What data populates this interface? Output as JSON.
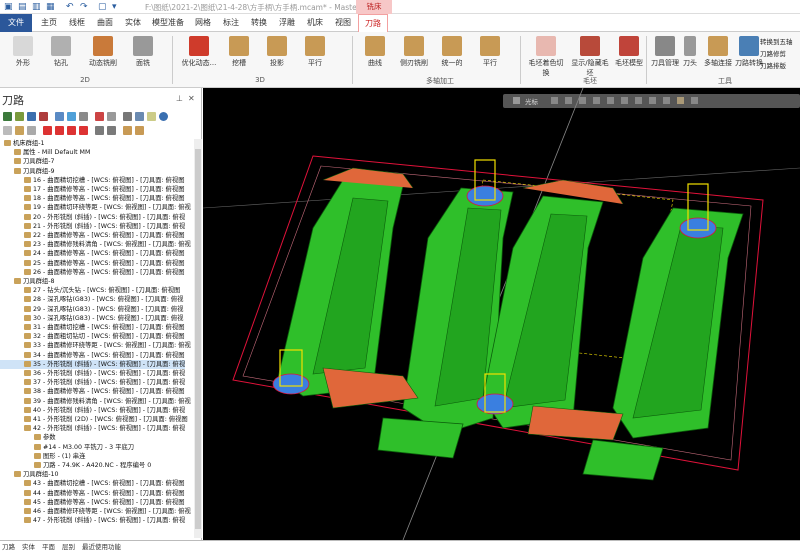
{
  "titlebar": {
    "path": "F:\\图纸\\2021-2\\图纸\\21-4-28\\方手柄\\方手柄.mcam* - Mastercam 铣...",
    "context_tab": "铣床"
  },
  "tabs": [
    "文件",
    "主页",
    "线框",
    "曲面",
    "实体",
    "模型准备",
    "网格",
    "标注",
    "转换",
    "浮雕",
    "机床",
    "视图",
    "刀路"
  ],
  "ribbon": {
    "buttons_2d": [
      "外形",
      "钻孔",
      "动态铣削",
      "面铣"
    ],
    "group_2d": "2D",
    "buttons_3d": [
      "优化动态...",
      "挖槽",
      "投影",
      "平行"
    ],
    "group_3d": "3D",
    "buttons_multi": [
      "曲线",
      "侧刃铣削",
      "统一的",
      "平行"
    ],
    "group_multi": "多轴加工",
    "buttons_stock": [
      "毛坯着色切换",
      "显示/隐藏毛坯",
      "毛坯模型"
    ],
    "group_stock": "毛坯",
    "buttons_tools": [
      "刀具管理",
      "刀头",
      "多轴连接",
      "刀路转换"
    ],
    "group_tools": "工具",
    "side_items": [
      "转换到五轴",
      "刀路修剪",
      "刀路排版"
    ]
  },
  "panel": {
    "title": "刀路",
    "tree": [
      {
        "indent": 0,
        "text": "机床群组-1"
      },
      {
        "indent": 1,
        "text": "属性 - Mill Default MM"
      },
      {
        "indent": 1,
        "text": "刀具群组-7"
      },
      {
        "indent": 1,
        "text": "刀具群组-9"
      },
      {
        "indent": 2,
        "text": "16 - 曲面精切挖槽 - [WCS: 俯视图] - [刀具面: 俯视图"
      },
      {
        "indent": 2,
        "text": "17 - 曲面精修等高 - [WCS: 俯视图] - [刀具面: 俯视图"
      },
      {
        "indent": 2,
        "text": "18 - 曲面精修等高 - [WCS: 俯视图] - [刀具面: 俯视图"
      },
      {
        "indent": 2,
        "text": "19 - 曲面精切环绕等距 - [WCS: 俯视图] - [刀具面: 俯视"
      },
      {
        "indent": 2,
        "text": "20 - 外形铣削 (斜插) - [WCS: 俯视图] - [刀具面: 俯视"
      },
      {
        "indent": 2,
        "text": "21 - 外形铣削 (斜插) - [WCS: 俯视图] - [刀具面: 俯视"
      },
      {
        "indent": 2,
        "text": "22 - 曲面精修等高 - [WCS: 俯视图] - [刀具面: 俯视图"
      },
      {
        "indent": 2,
        "text": "23 - 曲面精修残料清角 - [WCS: 俯视图] - [刀具面: 俯视"
      },
      {
        "indent": 2,
        "text": "24 - 曲面精修等高 - [WCS: 俯视图] - [刀具面: 俯视图"
      },
      {
        "indent": 2,
        "text": "25 - 曲面精修等高 - [WCS: 俯视图] - [刀具面: 俯视图"
      },
      {
        "indent": 2,
        "text": "26 - 曲面精修等高 - [WCS: 俯视图] - [刀具面: 俯视图"
      },
      {
        "indent": 1,
        "text": "刀具群组-8"
      },
      {
        "indent": 2,
        "text": "27 - 钻头/沉头钻 - [WCS: 俯视图] - [刀具面: 俯视图"
      },
      {
        "indent": 2,
        "text": "28 - 深孔啄钻(G83) - [WCS: 俯视图] - [刀具面: 俯视"
      },
      {
        "indent": 2,
        "text": "29 - 深孔啄钻(G83) - [WCS: 俯视图] - [刀具面: 俯视"
      },
      {
        "indent": 2,
        "text": "30 - 深孔啄钻(G83) - [WCS: 俯视图] - [刀具面: 俯视"
      },
      {
        "indent": 2,
        "text": "31 - 曲面精切挖槽 - [WCS: 俯视图] - [刀具面: 俯视图"
      },
      {
        "indent": 2,
        "text": "32 - 曲面粗切钻切 - [WCS: 俯视图] - [刀具面: 俯视图"
      },
      {
        "indent": 2,
        "text": "33 - 曲面精修环绕等距 - [WCS: 俯视图] - [刀具面: 俯视"
      },
      {
        "indent": 2,
        "text": "34 - 曲面精修等高 - [WCS: 俯视图] - [刀具面: 俯视图"
      },
      {
        "indent": 2,
        "text": "35 - 外形铣削 (斜插) - [WCS: 俯视图] - [刀具面: 俯视",
        "selected": true
      },
      {
        "indent": 2,
        "text": "36 - 外形铣削 (斜插) - [WCS: 俯视图] - [刀具面: 俯视"
      },
      {
        "indent": 2,
        "text": "37 - 外形铣削 (斜插) - [WCS: 俯视图] - [刀具面: 俯视"
      },
      {
        "indent": 2,
        "text": "38 - 曲面精修等高 - [WCS: 俯视图] - [刀具面: 俯视图"
      },
      {
        "indent": 2,
        "text": "39 - 曲面精修残料清角 - [WCS: 俯视图] - [刀具面: 俯视"
      },
      {
        "indent": 2,
        "text": "40 - 外形铣削 (斜插) - [WCS: 俯视图] - [刀具面: 俯视"
      },
      {
        "indent": 2,
        "text": "41 - 外形铣削 (2D) - [WCS: 俯视图] - [刀具面: 俯视图"
      },
      {
        "indent": 2,
        "text": "42 - 外形铣削 (斜插) - [WCS: 俯视图] - [刀具面: 俯视"
      },
      {
        "indent": 3,
        "text": "参数"
      },
      {
        "indent": 3,
        "text": "#14 - M3.00 平铣刀 - 3 平底刀"
      },
      {
        "indent": 3,
        "text": "图形 - (1) 串连"
      },
      {
        "indent": 3,
        "text": "刀路 - 74.9K - A420.NC - 程序编号 0"
      },
      {
        "indent": 1,
        "text": "刀具群组-10"
      },
      {
        "indent": 2,
        "text": "43 - 曲面精切挖槽 - [WCS: 俯视图] - [刀具面: 俯视图"
      },
      {
        "indent": 2,
        "text": "44 - 曲面精修等高 - [WCS: 俯视图] - [刀具面: 俯视图"
      },
      {
        "indent": 2,
        "text": "45 - 曲面精修等高 - [WCS: 俯视图] - [刀具面: 俯视图"
      },
      {
        "indent": 2,
        "text": "46 - 曲面精修环绕等距 - [WCS: 俯视图] - [刀具面: 俯视"
      },
      {
        "indent": 2,
        "text": "47 - 外形铣削 (斜插) - [WCS: 俯视图] - [刀具面: 俯视"
      }
    ]
  },
  "bottom_tabs": [
    "刀路",
    "实体",
    "平面",
    "层别",
    "最近使用功能"
  ],
  "viewport": {
    "toolbar_label": "光标"
  },
  "colors": {
    "file_tab": "#2b579a",
    "active_tab_text": "#cc2222",
    "part_green": "#2fbf2a",
    "toolpath_red": "#e0123a",
    "toolpath_yellow": "#f2e000"
  }
}
